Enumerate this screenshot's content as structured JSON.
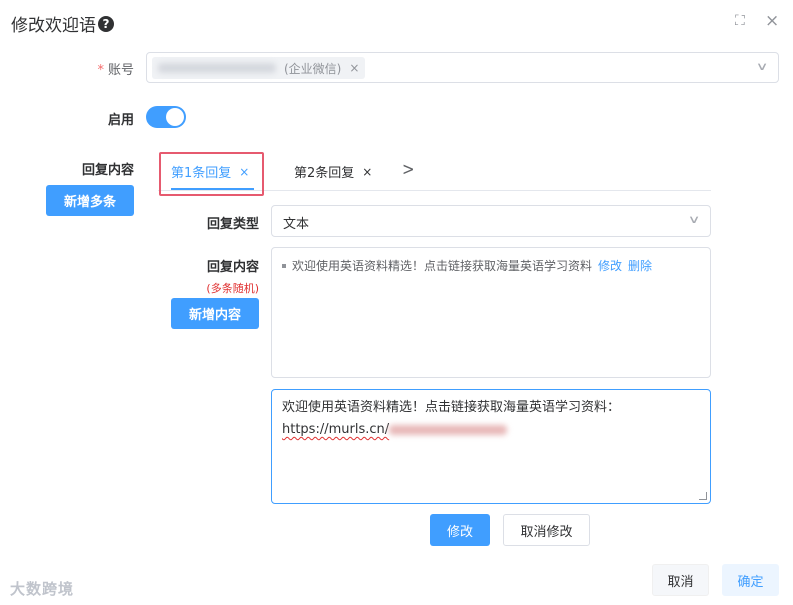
{
  "dialog": {
    "title": "修改欢迎语",
    "help_icon": "?",
    "maximize_icon": "⛶",
    "close_icon": "×"
  },
  "form": {
    "account": {
      "label": "账号",
      "required_mark": "*",
      "tag_suffix": "(企业微信)",
      "tag_close": "×"
    },
    "enable": {
      "label": "启用",
      "on": true
    },
    "reply_content": {
      "label": "回复内容",
      "add_multi_button": "新增多条"
    },
    "tabs": [
      {
        "label": "第1条回复",
        "close": "×",
        "active": true
      },
      {
        "label": "第2条回复",
        "close": "×",
        "active": false
      }
    ],
    "reply_type": {
      "label": "回复类型",
      "value": "文本"
    },
    "inner_content": {
      "label": "回复内容",
      "sub_label": "(多条随机)",
      "add_button": "新增内容",
      "items": [
        {
          "text": "欢迎使用英语资料精选！点击链接获取海量英语学习资料",
          "edit": "修改",
          "delete": "删除"
        }
      ]
    },
    "editor": {
      "line1": "欢迎使用英语资料精选！点击链接获取海量英语学习资料：",
      "url_prefix": "https://murls.cn/"
    },
    "editor_buttons": {
      "confirm": "修改",
      "cancel": "取消修改"
    }
  },
  "footer": {
    "cancel": "取消",
    "ok": "确定"
  },
  "watermark": "大数跨境",
  "colors": {
    "primary": "#409eff",
    "highlight": "#e65a6f",
    "required": "#f56c6c"
  }
}
